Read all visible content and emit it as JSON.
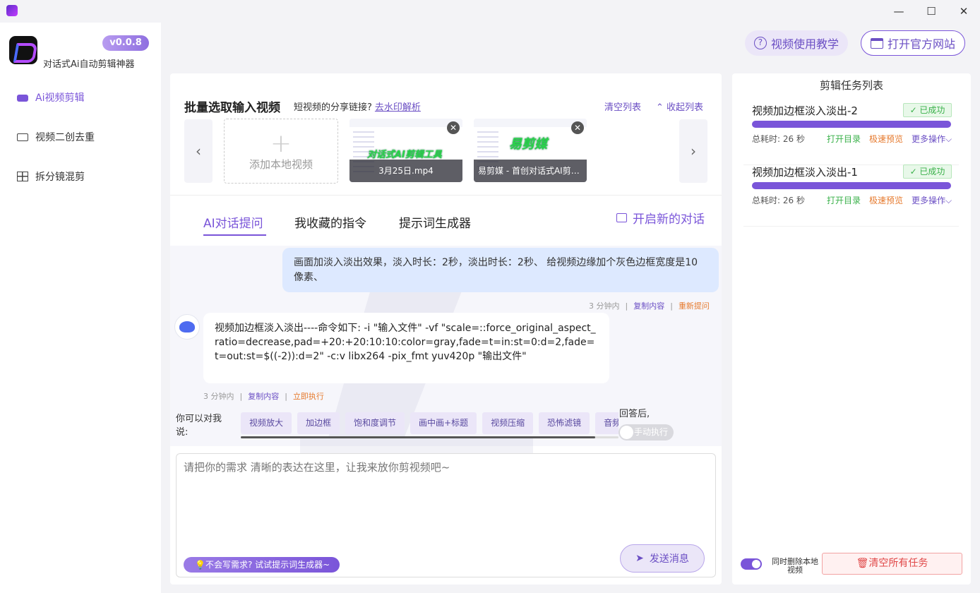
{
  "app": {
    "version": "v0.0.8",
    "brand": "对话式Ai自动剪辑神器"
  },
  "window": {
    "minimize": "—",
    "maximize": "☐",
    "close": "✕"
  },
  "sidebar": {
    "items": [
      {
        "label": "Ai视频剪辑",
        "icon": "video-camera-icon",
        "active": true
      },
      {
        "label": "视频二创去重",
        "icon": "video-icon",
        "active": false
      },
      {
        "label": "拆分镜混剪",
        "icon": "grid-icon",
        "active": false
      }
    ]
  },
  "topbar": {
    "tutorial": "视频使用教学",
    "website": "打开官方网站"
  },
  "input_section": {
    "title": "批量选取输入视频",
    "sub": "短视频的分享链接?",
    "sub_link": "去水印解析",
    "clear": "清空列表",
    "collapse": "收起列表",
    "add_local": "添加本地视频",
    "videos": [
      {
        "name": "3月25日.mp4",
        "overlay": "对话式AI剪辑工具"
      },
      {
        "name": "易剪媒 - 首创对话式AI剪辑工具",
        "overlay": "易剪媒"
      }
    ]
  },
  "tabs": [
    "AI对话提问",
    "我收藏的指令",
    "提示词生成器"
  ],
  "new_chat": "开启新的对话",
  "chat": {
    "user": "画面加淡入淡出效果，淡入时长：2秒，淡出时长：2秒、 给视频边缘加个灰色边框宽度是10像素、",
    "user_meta": {
      "time": "3 分钟内",
      "copy": "复制内容",
      "retry": "重新提问"
    },
    "bot": "视频加边框淡入淡出----命令如下: -i \"输入文件\" -vf \"scale=::force_original_aspect_ratio=decrease,pad=+20:+20:10:10:color=gray,fade=t=in:st=0:d=2,fade=t=out:st=$((-2)):d=2\" -c:v libx264 -pix_fmt yuv420p \"输出文件\"",
    "bot_meta": {
      "time": "3 分钟内",
      "copy": "复制内容",
      "run": "立即执行"
    }
  },
  "suggest": {
    "label": "你可以对我说:",
    "chips": [
      "视频放大",
      "加边框",
      "饱和度调节",
      "画中画+标题",
      "视频压缩",
      "恐怖滤镜",
      "音频"
    ]
  },
  "after_answer": "回答后,",
  "manual_exec": "手动执行",
  "composer": {
    "placeholder": "请把你的需求 清晰的表达在这里，让我来放你剪视频吧~",
    "hint": "💡不会写需求? 试试提示词生成器~",
    "send": "发送消息"
  },
  "tasks": {
    "title": "剪辑任务列表",
    "items": [
      {
        "name": "视频加边框淡入淡出-2",
        "status": "✓ 已成功",
        "progress": 1.0,
        "elapsed": "总耗时: 26 秒",
        "open": "打开目录",
        "preview": "极速预览",
        "more": "更多操作⌵"
      },
      {
        "name": "视频加边框淡入淡出-1",
        "status": "✓ 已成功",
        "progress": 1.0,
        "elapsed": "总耗时: 26 秒",
        "open": "打开目录",
        "preview": "极速预览",
        "more": "更多操作⌵"
      }
    ],
    "delete_local": "同时删除本地视频",
    "clear_all": "清空所有任务"
  },
  "colors": {
    "accent": "#7a55d9",
    "success": "#3ab14a",
    "warning": "#e67a2e",
    "danger": "#e04848"
  }
}
